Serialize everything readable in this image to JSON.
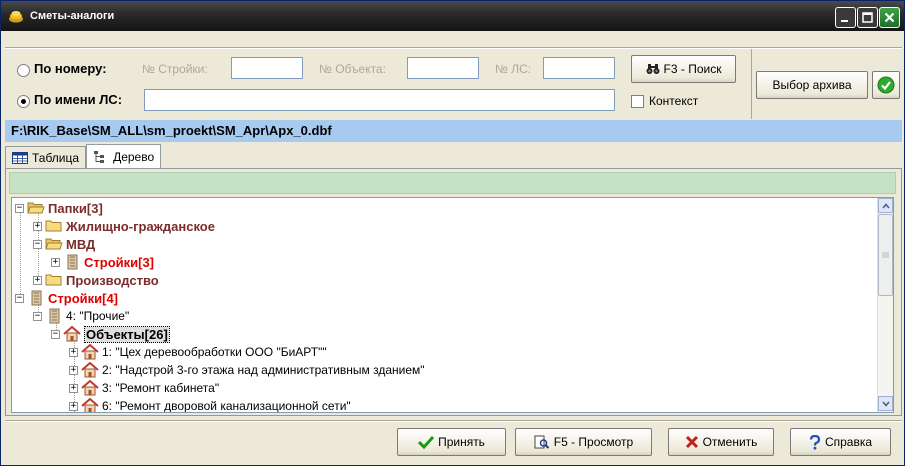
{
  "window": {
    "title": "Сметы-аналоги"
  },
  "search": {
    "by_number_label": "По номеру:",
    "by_name_label": "По имени ЛС:",
    "stroyka_label": "№ Стройки:",
    "stroyka_value": "",
    "object_label": "№ Объекта:",
    "object_value": "",
    "ls_label": "№ ЛС:",
    "ls_value": "",
    "name_value": "",
    "search_button": "F3 - Поиск",
    "context_label": "Контекст",
    "selected_mode": "by_name"
  },
  "archive": {
    "select_button": "Выбор архива"
  },
  "path": "F:\\RIK_Base\\SM_ALL\\sm_proekt\\SM_Apr\\Apx_0.dbf",
  "tabs": [
    {
      "label": "Таблица",
      "active": false
    },
    {
      "label": "Дерево",
      "active": true
    }
  ],
  "tree": {
    "nodes": [
      {
        "label": "Папки[3]",
        "style": "brown",
        "icon": "folder-open-icon",
        "expander": "−"
      },
      {
        "label": "Жилищно-гражданское",
        "style": "brown",
        "icon": "folder-icon",
        "expander": "+"
      },
      {
        "label": "МВД",
        "style": "brown",
        "icon": "folder-open-icon",
        "expander": "−"
      },
      {
        "label": "Стройки[3]",
        "style": "red",
        "icon": "building-icon",
        "expander": "+"
      },
      {
        "label": "Производство",
        "style": "brown",
        "icon": "folder-icon",
        "expander": "+"
      },
      {
        "label": "Стройки[4]",
        "style": "red",
        "icon": "building-icon",
        "expander": "−"
      },
      {
        "label": "4: \"Прочие\"",
        "style": "plain",
        "icon": "building-icon",
        "expander": "−"
      },
      {
        "label": "Объекты[26]",
        "style": "selected",
        "icon": "house-icon",
        "expander": "−"
      },
      {
        "label": "1: \"Цех деревообработки ООО \"БиАРТ\"\"",
        "style": "plain",
        "icon": "house-icon",
        "expander": "+"
      },
      {
        "label": "2: \"Надстрой 3-го этажа над административным зданием\"",
        "style": "plain",
        "icon": "house-icon",
        "expander": "+"
      },
      {
        "label": "3: \"Ремонт кабинета\"",
        "style": "plain",
        "icon": "house-icon",
        "expander": "+"
      },
      {
        "label": "6: \"Ремонт дворовой канализационной сети\"",
        "style": "plain",
        "icon": "house-icon",
        "expander": "+"
      }
    ]
  },
  "footer": {
    "accept": "Принять",
    "preview": "F5 - Просмотр",
    "cancel": "Отменить",
    "help": "Справка"
  }
}
